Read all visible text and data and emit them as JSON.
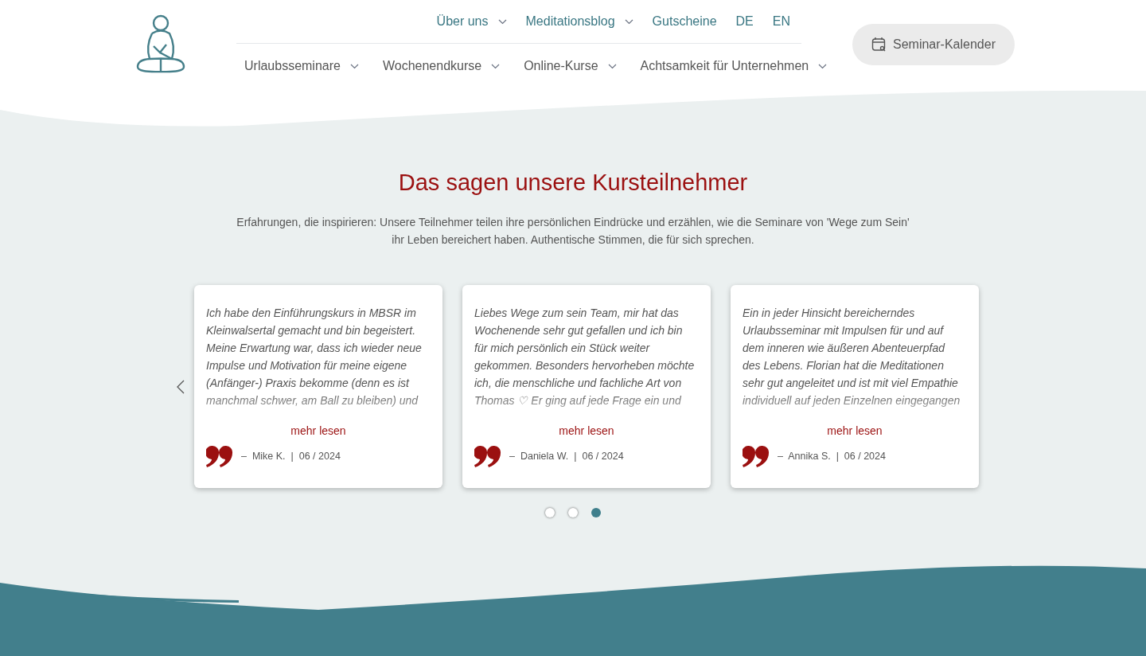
{
  "header": {
    "top_nav": [
      {
        "label": "Über uns",
        "dropdown": true
      },
      {
        "label": "Meditationsblog",
        "dropdown": true
      },
      {
        "label": "Gutscheine",
        "dropdown": false
      },
      {
        "label": "DE",
        "dropdown": false
      },
      {
        "label": "EN",
        "dropdown": false
      }
    ],
    "main_nav": [
      {
        "label": "Urlaubsseminare",
        "dropdown": true
      },
      {
        "label": "Wochenendkurse",
        "dropdown": true
      },
      {
        "label": "Online-Kurse",
        "dropdown": true
      },
      {
        "label": "Achtsamkeit für Unternehmen",
        "dropdown": true
      }
    ],
    "cta": "Seminar-Kalender"
  },
  "testimonials": {
    "title": "Das sagen unsere Kursteilnehmer",
    "intro": [
      "Erfahrungen, die inspirieren: Unsere Teilnehmer teilen ihre persönlichen Eindrücke und erzählen, wie die Seminare von 'Wege zum Sein'",
      "ihr Leben bereichert haben. Authentische Stimmen, die für sich sprechen."
    ],
    "cards": [
      {
        "lines": [
          "Ich habe den Einführungskurs in MBSR im",
          "Kleinwalsertal gemacht und bin begeistert.",
          "Meine Erwartung war, dass ich wieder neue",
          "Impulse und Motivation für meine eigene",
          "(Anfänger-) Praxis bekomme (denn es ist",
          "manchmal schwer, am Ball zu bleiben) und"
        ],
        "more": "mehr lesen",
        "author": "–  Mike K.  |  06 / 2024"
      },
      {
        "lines": [
          "Liebes Wege zum sein Team, mir hat das",
          "Wochenende sehr gut gefallen und ich bin",
          "für mich persönlich ein Stück weiter",
          "gekommen. Besonders hervorheben möchte",
          "ich, die menschliche und fachliche Art von",
          "Thomas ♡ Er ging auf jede Frage ein und"
        ],
        "more": "mehr lesen",
        "author": "–  Daniela W.  |  06 / 2024"
      },
      {
        "lines": [
          "Ein in jeder Hinsicht bereicherndes",
          "Urlaubsseminar mit Impulsen für und auf",
          "dem inneren wie äußeren Abenteuerpfad",
          "des Lebens. Florian hat die Meditationen",
          "sehr gut angeleitet und ist mit viel Empathie",
          "individuell auf jeden Einzelnen eingegangen"
        ],
        "more": "mehr lesen",
        "author": "–  Annika S.  |  06 / 2024"
      }
    ],
    "dots": [
      {
        "selected": false
      },
      {
        "selected": false
      },
      {
        "selected": true
      }
    ]
  }
}
